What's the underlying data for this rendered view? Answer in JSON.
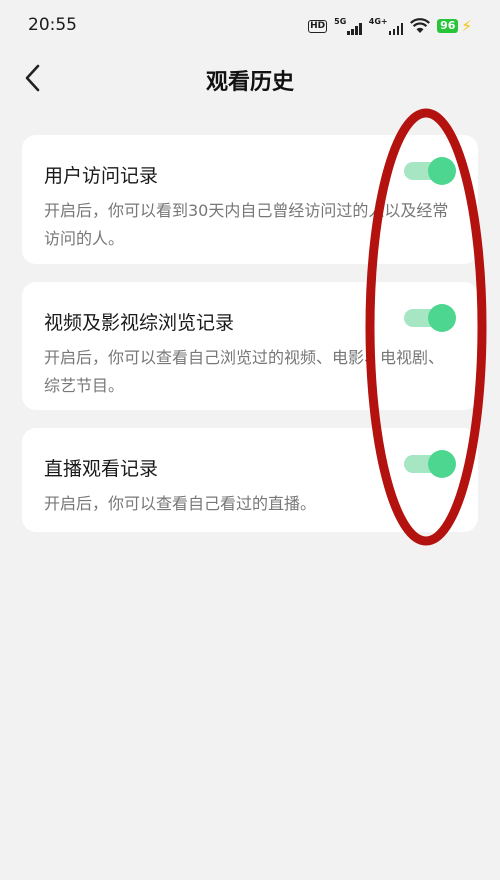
{
  "status_bar": {
    "time": "20:55",
    "hd_label": "HD",
    "net1_label": "5G",
    "net2_label": "4G+",
    "battery": "96"
  },
  "header": {
    "title": "观看历史",
    "back_icon": "chevron-left-icon"
  },
  "settings": [
    {
      "title": "用户访问记录",
      "description": "开启后，你可以看到30天内自己曾经访问过的人以及经常访问的人。",
      "enabled": true
    },
    {
      "title": "视频及影视综浏览记录",
      "description": "开启后，你可以查看自己浏览过的视频、电影、电视剧、综艺节目。",
      "enabled": true
    },
    {
      "title": "直播观看记录",
      "description": "开启后，你可以查看自己看过的直播。",
      "enabled": true
    }
  ],
  "colors": {
    "background": "#f2f2f2",
    "card": "#ffffff",
    "toggle_track": "#a6e6c3",
    "toggle_knob": "#4dd68f",
    "annotation": "#b3120f",
    "battery": "#28c53a"
  }
}
